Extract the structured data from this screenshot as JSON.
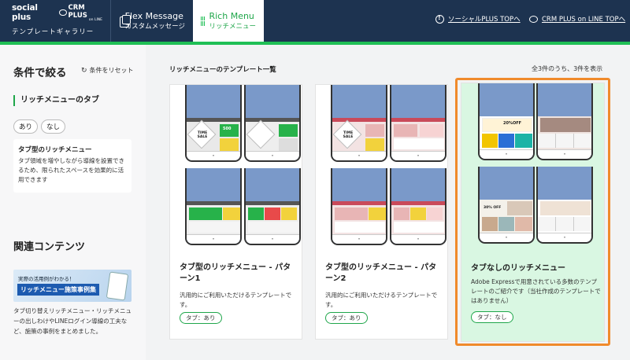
{
  "header": {
    "brand_socialplus": "social plus",
    "brand_crmplus": "CRM PLUS",
    "brand_crmplus_sub": "on LINE",
    "brand_subtitle": "テンプレートギャラリー",
    "tabs": [
      {
        "title": "Flex Message",
        "subtitle": "カスタムメッセージ",
        "icon": "message-icon",
        "active": false
      },
      {
        "title": "Rich Menu",
        "subtitle": "リッチメニュー",
        "icon": "grid-icon",
        "active": true
      }
    ],
    "links": [
      {
        "label": "ソーシャルPLUS TOPへ",
        "icon": "info-circle-icon"
      },
      {
        "label": "CRM PLUS on LINE TOPへ",
        "icon": "chat-bubble-icon"
      }
    ],
    "colors": {
      "background": "#1d3350",
      "accent": "#1fbf55"
    }
  },
  "sidebar": {
    "filter_title": "条件で絞る",
    "reset_label": "条件をリセット",
    "tab_heading": "リッチメニューのタブ",
    "chips": [
      "あり",
      "なし"
    ],
    "desc_title": "タブ型のリッチメニュー",
    "desc_text": "タブ領域を増やしながら導線を設置できるため、限られたスペースを効果的に活用できます",
    "related_title": "関連コンテンツ",
    "banner_line1": "実際の活用例がわかる！",
    "banner_line2": "リッチメニュー施策事例集",
    "related_text": "タブ切り替えリッチメニュー・リッチメニューの出しわけやLINEログイン導線の工夫など、施策の事例をまとめました。"
  },
  "main": {
    "title": "リッチメニューのテンプレート一覧",
    "count": "全3件のうち、3件を表示",
    "selected_color": "#f08a2b",
    "cards": [
      {
        "title": "タブ型のリッチメニュー - パターン1",
        "desc": "汎用的にご利用いただけるテンプレートです。",
        "tag": "タブ：あり",
        "sale_text": "TIME SALE",
        "price_text": "500"
      },
      {
        "title": "タブ型のリッチメニュー - パターン2",
        "desc": "汎用的にご利用いただけるテンプレートです。",
        "tag": "タブ：あり",
        "sale_text": "TIME SALE",
        "price_text": "500"
      },
      {
        "title": "タブなしのリッチメニュー",
        "desc": "Adobe Expressで用意されている多数のテンプレートのご紹介です（当社作成のテンプレートではありません）",
        "tag": "タブ：なし",
        "sale_text": "20%OFF",
        "price_text": "30% OFF"
      }
    ]
  }
}
